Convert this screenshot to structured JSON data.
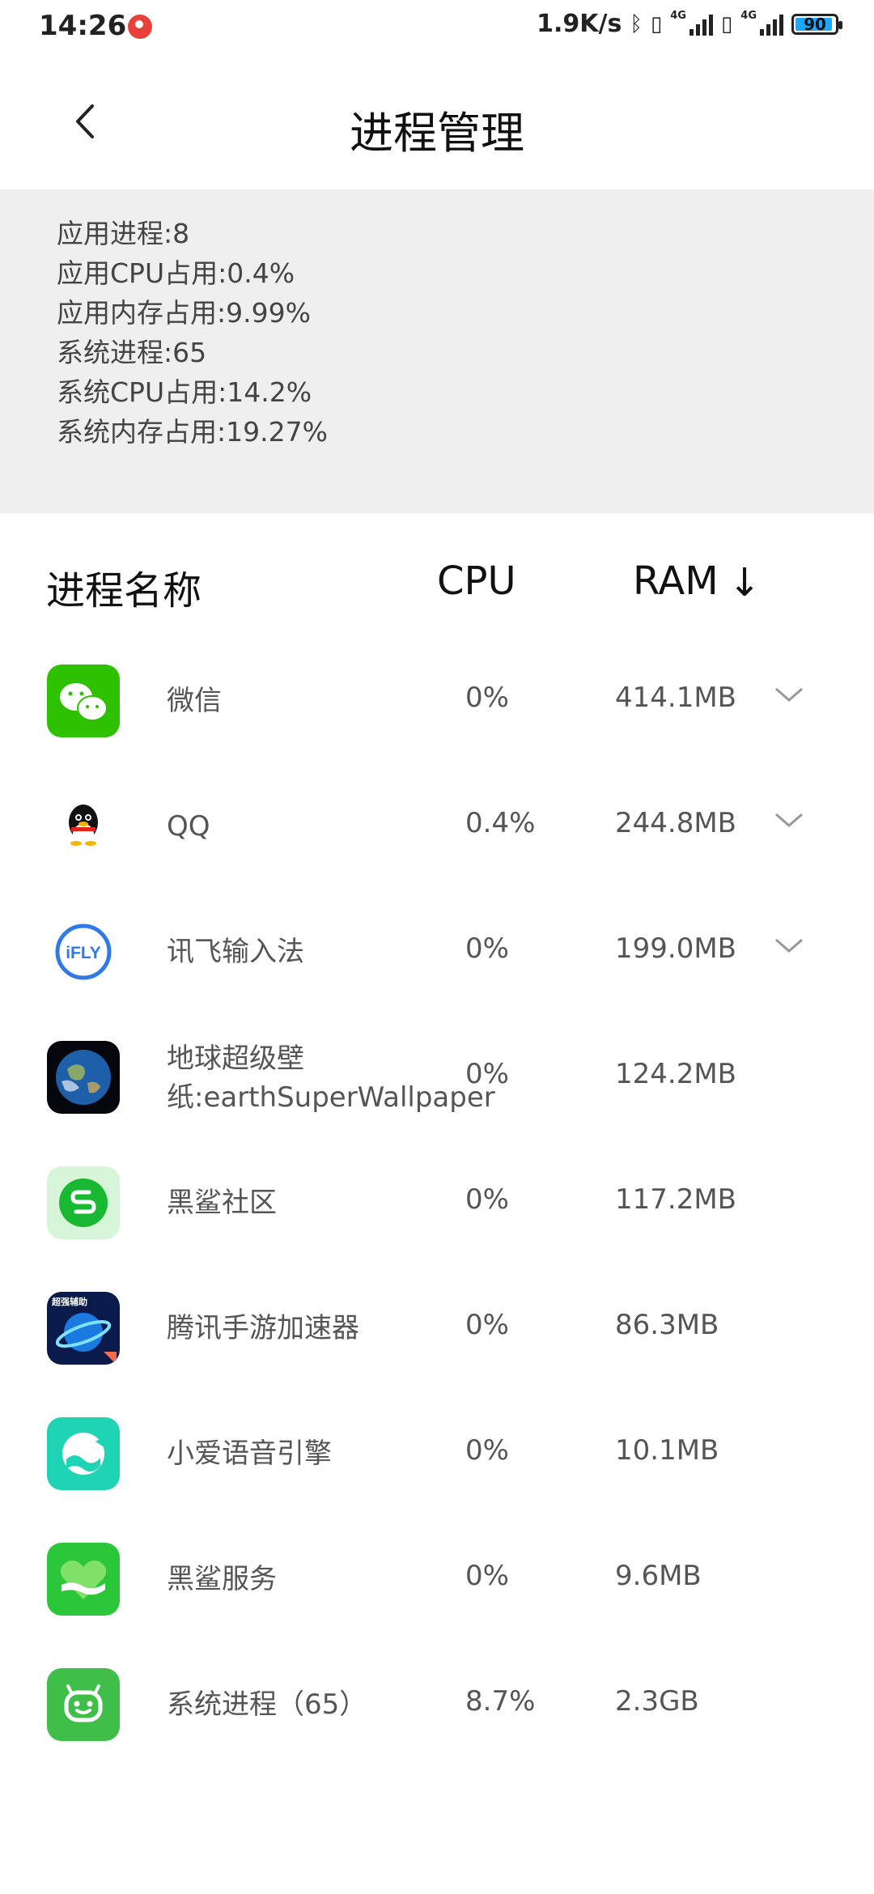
{
  "status_bar": {
    "time": "14:26",
    "net_speed": "1.9K/s",
    "network_badge": "4G",
    "battery": "90",
    "icons": [
      "notification-icon",
      "bluetooth-icon",
      "sim-icon",
      "signal-icon",
      "battery-icon"
    ]
  },
  "header": {
    "title": "进程管理",
    "back_icon": "back-arrow-icon"
  },
  "summary": {
    "app_processes": "应用进程:8",
    "app_cpu": "应用CPU占用:0.4%",
    "app_mem": "应用内存占用:9.99%",
    "sys_processes": "系统进程:65",
    "sys_cpu": "系统CPU占用:14.2%",
    "sys_mem": "系统内存占用:19.27%"
  },
  "columns": {
    "name": "进程名称",
    "cpu": "CPU",
    "ram": "RAM",
    "sort_indicator": "↓"
  },
  "processes": [
    {
      "name": "微信",
      "cpu": "0%",
      "ram": "414.1MB",
      "icon": "wechat-icon",
      "expandable": true
    },
    {
      "name": "QQ",
      "cpu": "0.4%",
      "ram": "244.8MB",
      "icon": "qq-penguin-icon",
      "expandable": true
    },
    {
      "name": "讯飞输入法",
      "cpu": "0%",
      "ram": "199.0MB",
      "icon": "ifly-icon",
      "icon_text": "iFLY",
      "expandable": true
    },
    {
      "name": "地球超级壁纸:earthSuperWallpaper",
      "cpu": "0%",
      "ram": "124.2MB",
      "icon": "earth-icon",
      "expandable": false
    },
    {
      "name": "黑鲨社区",
      "cpu": "0%",
      "ram": "117.2MB",
      "icon": "blackshark-community-icon",
      "expandable": false
    },
    {
      "name": "腾讯手游加速器",
      "cpu": "0%",
      "ram": "86.3MB",
      "icon": "game-booster-icon",
      "icon_text": "超强辅助",
      "expandable": false
    },
    {
      "name": "小爱语音引擎",
      "cpu": "0%",
      "ram": "10.1MB",
      "icon": "xiaoai-icon",
      "expandable": false
    },
    {
      "name": "黑鲨服务",
      "cpu": "0%",
      "ram": "9.6MB",
      "icon": "blackshark-service-icon",
      "expandable": false
    },
    {
      "name": "系统进程（65）",
      "cpu": "8.7%",
      "ram": "2.3GB",
      "icon": "system-android-icon",
      "expandable": false
    }
  ]
}
